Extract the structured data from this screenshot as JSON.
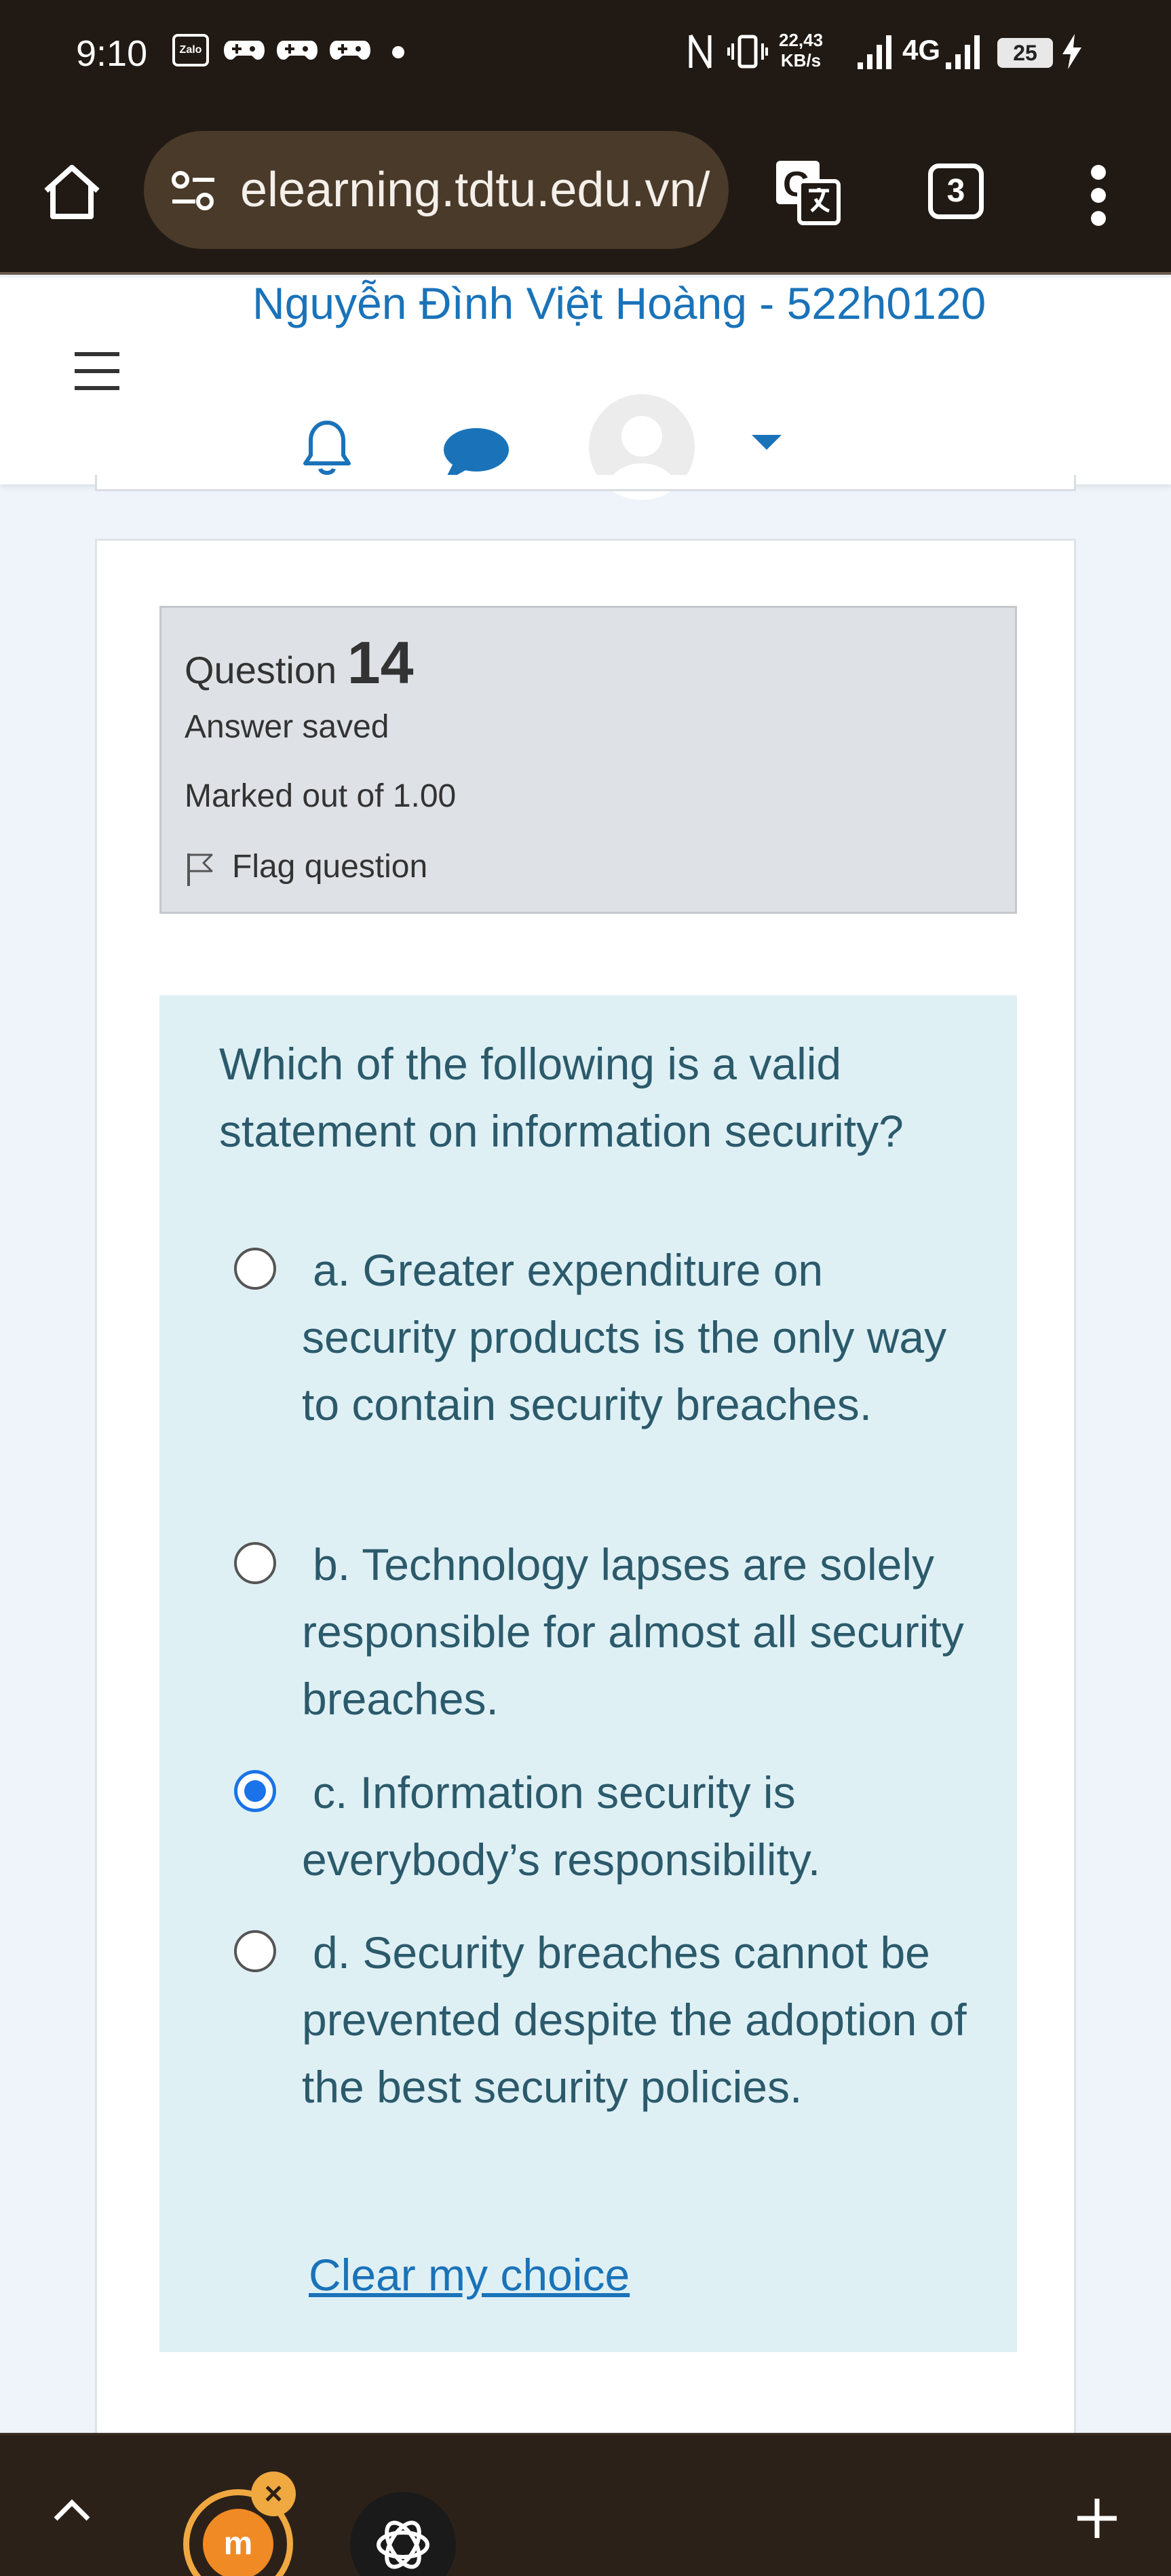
{
  "status_bar": {
    "time": "9:10",
    "zalo_label": "Zalo",
    "speed_value": "22,43",
    "speed_unit": "KB/s",
    "network": "4G",
    "battery": "25"
  },
  "browser": {
    "url": "elearning.tdtu.edu.vn/",
    "tab_count": "3"
  },
  "header": {
    "user_name": "Nguyễn Đình Việt Hoàng - 522h0120"
  },
  "question": {
    "label": "Question",
    "number": "14",
    "state": "Answer saved",
    "marks": "Marked out of 1.00",
    "flag_label": "Flag question",
    "text": "Which of the following is a valid statement on information security?",
    "options": [
      {
        "text": "a. Greater expenditure on security products is the only way to contain security breaches.",
        "checked": false
      },
      {
        "text": "b. Technology lapses are solely responsible for almost all security breaches.",
        "checked": false
      },
      {
        "text": "c. Information security is everybody’s responsibility.",
        "checked": true
      },
      {
        "text": "d. Security breaches cannot be prevented despite the adoption of the best security policies.",
        "checked": false
      }
    ],
    "clear_label": "Clear my choice"
  },
  "bottom_bar": {
    "moodle_bubble_letter": "m"
  },
  "colors": {
    "accent": "#1a73b9",
    "radio_checked": "#1a73e8",
    "question_bg": "#dff0f5",
    "info_bg": "#dee2e6",
    "browser_bg": "#211a14"
  }
}
